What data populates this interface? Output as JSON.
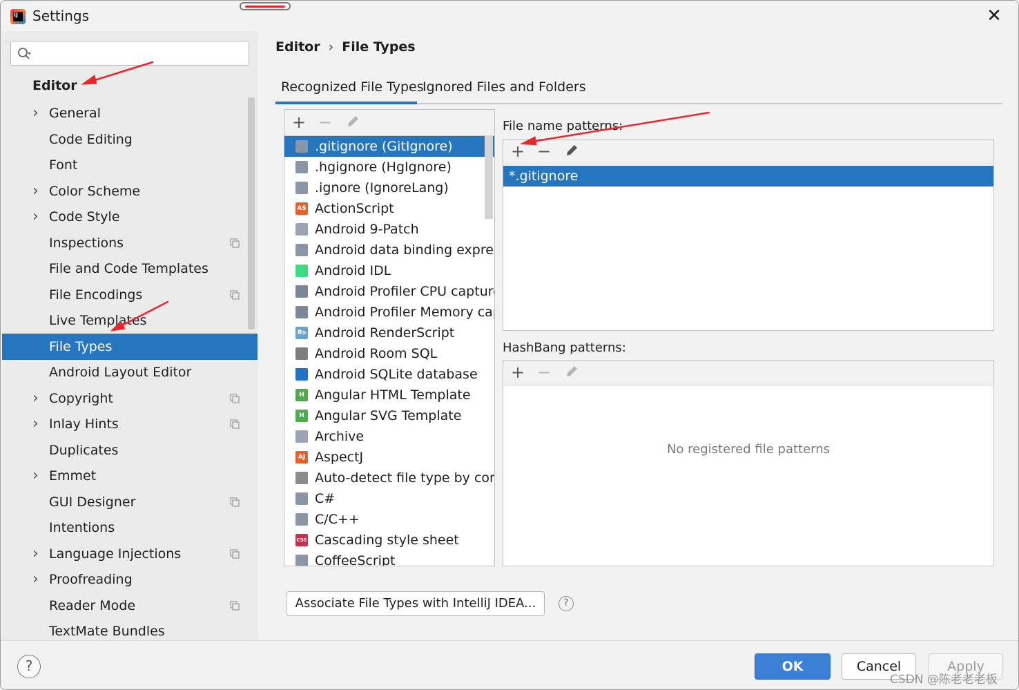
{
  "window": {
    "title": "Settings"
  },
  "search": {
    "placeholder": "",
    "value": ""
  },
  "sidebar": {
    "section": "Editor",
    "items": [
      {
        "label": "General",
        "expandable": true,
        "project": false
      },
      {
        "label": "Code Editing",
        "expandable": false,
        "project": false
      },
      {
        "label": "Font",
        "expandable": false,
        "project": false
      },
      {
        "label": "Color Scheme",
        "expandable": true,
        "project": false
      },
      {
        "label": "Code Style",
        "expandable": true,
        "project": false
      },
      {
        "label": "Inspections",
        "expandable": false,
        "project": true
      },
      {
        "label": "File and Code Templates",
        "expandable": false,
        "project": false
      },
      {
        "label": "File Encodings",
        "expandable": false,
        "project": true
      },
      {
        "label": "Live Templates",
        "expandable": false,
        "project": false
      },
      {
        "label": "File Types",
        "expandable": false,
        "project": false,
        "selected": true
      },
      {
        "label": "Android Layout Editor",
        "expandable": false,
        "project": false
      },
      {
        "label": "Copyright",
        "expandable": true,
        "project": true
      },
      {
        "label": "Inlay Hints",
        "expandable": true,
        "project": true
      },
      {
        "label": "Duplicates",
        "expandable": false,
        "project": false
      },
      {
        "label": "Emmet",
        "expandable": true,
        "project": false
      },
      {
        "label": "GUI Designer",
        "expandable": false,
        "project": true
      },
      {
        "label": "Intentions",
        "expandable": false,
        "project": false
      },
      {
        "label": "Language Injections",
        "expandable": true,
        "project": true
      },
      {
        "label": "Proofreading",
        "expandable": true,
        "project": false
      },
      {
        "label": "Reader Mode",
        "expandable": false,
        "project": true
      },
      {
        "label": "TextMate Bundles",
        "expandable": false,
        "project": false
      }
    ]
  },
  "breadcrumb": {
    "parent": "Editor",
    "separator": "›",
    "current": "File Types"
  },
  "tabs": [
    {
      "label": "Recognized File Types",
      "active": true
    },
    {
      "label": "Ignored Files and Folders",
      "active": false
    }
  ],
  "file_types": [
    {
      "label": ".gitignore (GitIgnore)",
      "icon": "ignore-file-icon",
      "icon_text": "",
      "color": "#8a96a6",
      "selected": true
    },
    {
      "label": ".hgignore (HgIgnore)",
      "icon": "ignore-file-icon",
      "icon_text": "",
      "color": "#8a96a6"
    },
    {
      "label": ".ignore (IgnoreLang)",
      "icon": "ignore-file-icon",
      "icon_text": "",
      "color": "#8a96a6"
    },
    {
      "label": "ActionScript",
      "icon": "actionscript-icon",
      "icon_text": "AS",
      "color": "#e5622c"
    },
    {
      "label": "Android 9-Patch",
      "icon": "folder-icon",
      "icon_text": "",
      "color": "#9aa4b2"
    },
    {
      "label": "Android data binding expressi",
      "icon": "android-file-icon",
      "icon_text": "",
      "color": "#8a96a6"
    },
    {
      "label": "Android IDL",
      "icon": "android-icon",
      "icon_text": "",
      "color": "#3ddc84"
    },
    {
      "label": "Android Profiler CPU capture f",
      "icon": "profiler-icon",
      "icon_text": "",
      "color": "#7a8796"
    },
    {
      "label": "Android Profiler Memory capt",
      "icon": "profiler-icon",
      "icon_text": "",
      "color": "#7a8796"
    },
    {
      "label": "Android RenderScript",
      "icon": "renderscript-icon",
      "icon_text": "Rs",
      "color": "#6aa2c8"
    },
    {
      "label": "Android Room SQL",
      "icon": "database-icon",
      "icon_text": "",
      "color": "#7d7d7d"
    },
    {
      "label": "Android SQLite database",
      "icon": "sqlite-icon",
      "icon_text": "",
      "color": "#1f74c9"
    },
    {
      "label": "Angular HTML Template",
      "icon": "html-file-icon",
      "icon_text": "H",
      "color": "#4fa94d"
    },
    {
      "label": "Angular SVG Template",
      "icon": "html-file-icon",
      "icon_text": "H",
      "color": "#4fa94d"
    },
    {
      "label": "Archive",
      "icon": "archive-icon",
      "icon_text": "",
      "color": "#9aa4b2"
    },
    {
      "label": "AspectJ",
      "icon": "aspectj-icon",
      "icon_text": "AJ",
      "color": "#e5622c"
    },
    {
      "label": "Auto-detect file type by conte",
      "icon": "text-file-icon",
      "icon_text": "",
      "color": "#8a8a8a"
    },
    {
      "label": "C#",
      "icon": "csharp-file-icon",
      "icon_text": "",
      "color": "#8a96a6"
    },
    {
      "label": "C/C++",
      "icon": "cpp-file-icon",
      "icon_text": "",
      "color": "#8a96a6"
    },
    {
      "label": "Cascading style sheet",
      "icon": "css-icon",
      "icon_text": "CSS",
      "color": "#c2334d"
    },
    {
      "label": "CoffeeScript",
      "icon": "coffeescript-icon",
      "icon_text": "",
      "color": "#8a96a6"
    }
  ],
  "file_name_patterns": {
    "label": "File name patterns:",
    "items": [
      "*.gitignore"
    ]
  },
  "hashbang_patterns": {
    "label": "HashBang patterns:",
    "empty_text": "No registered file patterns"
  },
  "associate_button": "Associate File Types with IntelliJ IDEA...",
  "footer": {
    "ok": "OK",
    "cancel": "Cancel",
    "apply": "Apply"
  },
  "watermark": "CSDN @陈老老老板",
  "colors": {
    "accent": "#2675bf",
    "ok_button": "#3b7fd6",
    "annotation_arrow": "#e8262b"
  }
}
